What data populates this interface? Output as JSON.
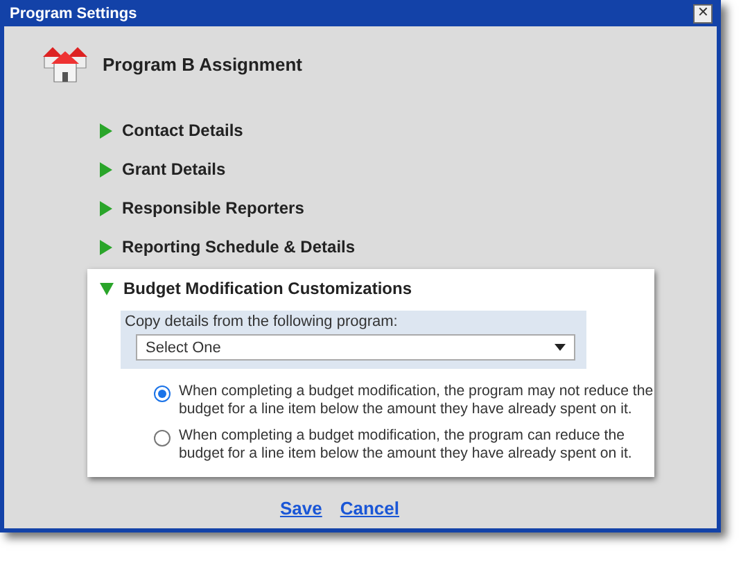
{
  "window": {
    "title": "Program Settings",
    "close": "✕"
  },
  "header": {
    "title": "Program B Assignment"
  },
  "sections": [
    {
      "label": "Contact Details",
      "expanded": false
    },
    {
      "label": "Grant Details",
      "expanded": false
    },
    {
      "label": "Responsible Reporters",
      "expanded": false
    },
    {
      "label": "Reporting Schedule & Details",
      "expanded": false
    },
    {
      "label": "Budget Modification Customizations",
      "expanded": true,
      "copy_label": "Copy details from the following program:",
      "select": {
        "value": "Select One"
      },
      "options": [
        {
          "label": "When completing a budget modification, the program may not reduce the budget for a line item below the amount they have already spent on it.",
          "selected": true
        },
        {
          "label": "When completing a budget modification, the program can reduce the budget for a line item below the amount they have already spent on it.",
          "selected": false
        }
      ]
    }
  ],
  "buttons": [
    "Save",
    "Cancel"
  ]
}
